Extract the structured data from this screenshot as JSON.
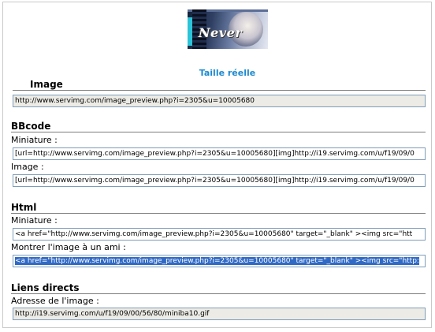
{
  "thumbnail": {
    "title": "Never"
  },
  "real_size_link": "Taille réelle",
  "sections": {
    "image": {
      "heading": "Image",
      "url": "http://www.servimg.com/image_preview.php?i=2305&u=10005680"
    },
    "bbcode": {
      "heading": "BBcode",
      "miniature_label": "Miniature :",
      "miniature_value": "[url=http://www.servimg.com/image_preview.php?i=2305&u=10005680][img]http://i19.servimg.com/u/f19/09/0",
      "image_label": "Image :",
      "image_value": "[url=http://www.servimg.com/image_preview.php?i=2305&u=10005680][img]http://i19.servimg.com/u/f19/09/0"
    },
    "html": {
      "heading": "Html",
      "miniature_label": "Miniature :",
      "miniature_value": "<a href=\"http://www.servimg.com/image_preview.php?i=2305&u=10005680\"  target=\"_blank\" ><img src=\"htt",
      "friend_label": "Montrer l'image à un ami :",
      "friend_value": "<a href=\"http://www.servimg.com/image_preview.php?i=2305&u=10005680\" target=\"_blank\" ><img src=\"http:"
    },
    "direct": {
      "heading": "Liens directs",
      "address_label": "Adresse de l'image :",
      "address_value": "http://i19.servimg.com/u/f19/09/00/56/80/miniba10.gif"
    }
  },
  "colors": {
    "link": "#1c8ad0",
    "selection": "#316ac5",
    "readonly_field": "#ecebe5"
  }
}
